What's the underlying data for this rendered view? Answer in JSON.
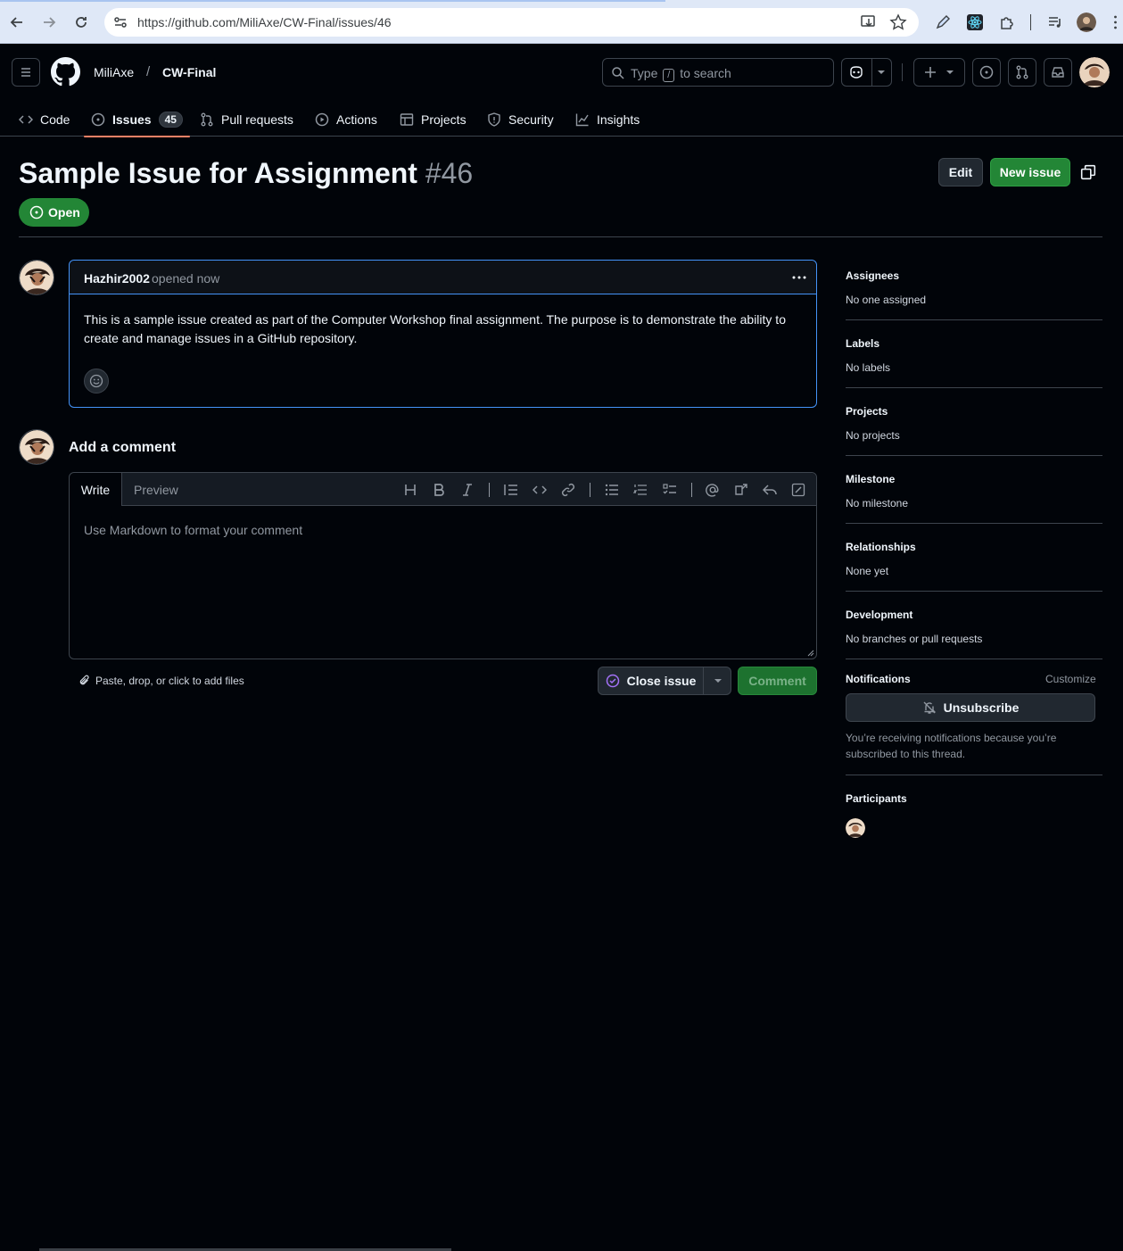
{
  "browser": {
    "url": "https://github.com/MiliAxe/CW-Final/issues/46"
  },
  "header": {
    "owner": "MiliAxe",
    "separator": "/",
    "repo": "CW-Final",
    "search_prefix": "Type",
    "search_key": "/",
    "search_suffix": "to search"
  },
  "tabs": [
    {
      "label": "Code",
      "icon": "code-icon"
    },
    {
      "label": "Issues",
      "icon": "issue-opened-icon",
      "count": "45",
      "active": true
    },
    {
      "label": "Pull requests",
      "icon": "git-pull-request-icon"
    },
    {
      "label": "Actions",
      "icon": "play-icon"
    },
    {
      "label": "Projects",
      "icon": "table-icon"
    },
    {
      "label": "Security",
      "icon": "shield-icon"
    },
    {
      "label": "Insights",
      "icon": "graph-icon"
    }
  ],
  "issue": {
    "title": "Sample Issue for Assignment",
    "number": "#46",
    "state": "Open",
    "edit_label": "Edit",
    "new_issue_label": "New issue"
  },
  "comment": {
    "author": "Hazhir2002",
    "meta": "opened now",
    "body": "This is a sample issue created as part of the Computer Workshop final assignment. The purpose is to demonstrate the ability to create and manage issues in a GitHub repository."
  },
  "composer": {
    "title": "Add a comment",
    "write_tab": "Write",
    "preview_tab": "Preview",
    "placeholder": "Use Markdown to format your comment",
    "attach_label": "Paste, drop, or click to add files",
    "close_issue_label": "Close issue",
    "comment_label": "Comment"
  },
  "sidebar": {
    "assignees": {
      "title": "Assignees",
      "value": "No one assigned"
    },
    "labels": {
      "title": "Labels",
      "value": "No labels"
    },
    "projects": {
      "title": "Projects",
      "value": "No projects"
    },
    "milestone": {
      "title": "Milestone",
      "value": "No milestone"
    },
    "relationships": {
      "title": "Relationships",
      "value": "None yet"
    },
    "development": {
      "title": "Development",
      "value": "No branches or pull requests"
    },
    "notifications": {
      "title": "Notifications",
      "customize": "Customize",
      "unsubscribe": "Unsubscribe",
      "reason": "You’re receiving notifications because you’re subscribed to this thread."
    },
    "participants": {
      "title": "Participants"
    }
  },
  "colors": {
    "background": "#010409",
    "accent_green": "#238636",
    "accent_blue": "#4493f8",
    "tab_underline": "#f78166"
  }
}
